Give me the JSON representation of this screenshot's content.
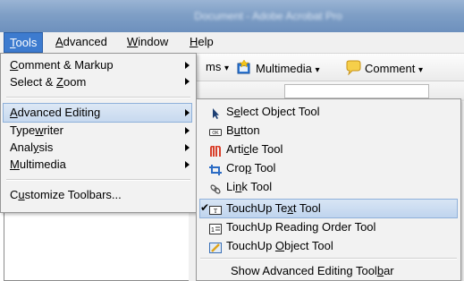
{
  "window": {
    "title": "Document - Adobe Acrobat Pro"
  },
  "menubar": {
    "tools": {
      "pre": "",
      "acc": "T",
      "post": "ools"
    },
    "advanced": {
      "pre": "",
      "acc": "A",
      "post": "dvanced"
    },
    "window": {
      "pre": "",
      "acc": "W",
      "post": "indow"
    },
    "help": {
      "pre": "",
      "acc": "H",
      "post": "elp"
    }
  },
  "toolbar": {
    "forms_fragment": "ms",
    "multimedia_label": "Multimedia",
    "comment_label": "Comment",
    "dropdown_glyph": "▾"
  },
  "tools_menu": {
    "comment_markup": {
      "pre": "",
      "acc": "C",
      "post": "omment & Markup"
    },
    "select_zoom": {
      "pre": "Select & ",
      "acc": "Z",
      "post": "oom"
    },
    "advanced_editing": {
      "pre": "",
      "acc": "A",
      "post": "dvanced Editing"
    },
    "typewriter": {
      "pre": "Type",
      "acc": "w",
      "post": "riter"
    },
    "analysis": {
      "pre": "Anal",
      "acc": "y",
      "post": "sis"
    },
    "multimedia": {
      "pre": "",
      "acc": "M",
      "post": "ultimedia"
    },
    "customize": {
      "pre": "C",
      "acc": "u",
      "post": "stomize Toolbars..."
    }
  },
  "advanced_editing_menu": {
    "select_object": {
      "pre": "S",
      "acc": "e",
      "post": "lect Object Tool"
    },
    "button": {
      "pre": "B",
      "acc": "u",
      "post": "tton"
    },
    "article": {
      "pre": "Arti",
      "acc": "c",
      "post": "le Tool"
    },
    "crop": {
      "pre": "Cro",
      "acc": "p",
      "post": " Tool"
    },
    "link": {
      "pre": "Li",
      "acc": "n",
      "post": "k Tool"
    },
    "touchup_text": {
      "pre": "TouchUp Te",
      "acc": "x",
      "post": "t Tool"
    },
    "touchup_reading": {
      "pre": "TouchUp Readin",
      "acc": "g",
      "post": " Order Tool"
    },
    "touchup_object": {
      "pre": "TouchUp ",
      "acc": "O",
      "post": "bject Tool"
    },
    "show_toolbar": {
      "pre": "Show Advanced Editing Tool",
      "acc": "b",
      "post": "ar"
    },
    "checkmark": "✔"
  },
  "colors": {
    "menu_highlight": "#c7d9ef",
    "menubar_active": "#3d7bcf",
    "titlebar": "#7f9fc6"
  }
}
